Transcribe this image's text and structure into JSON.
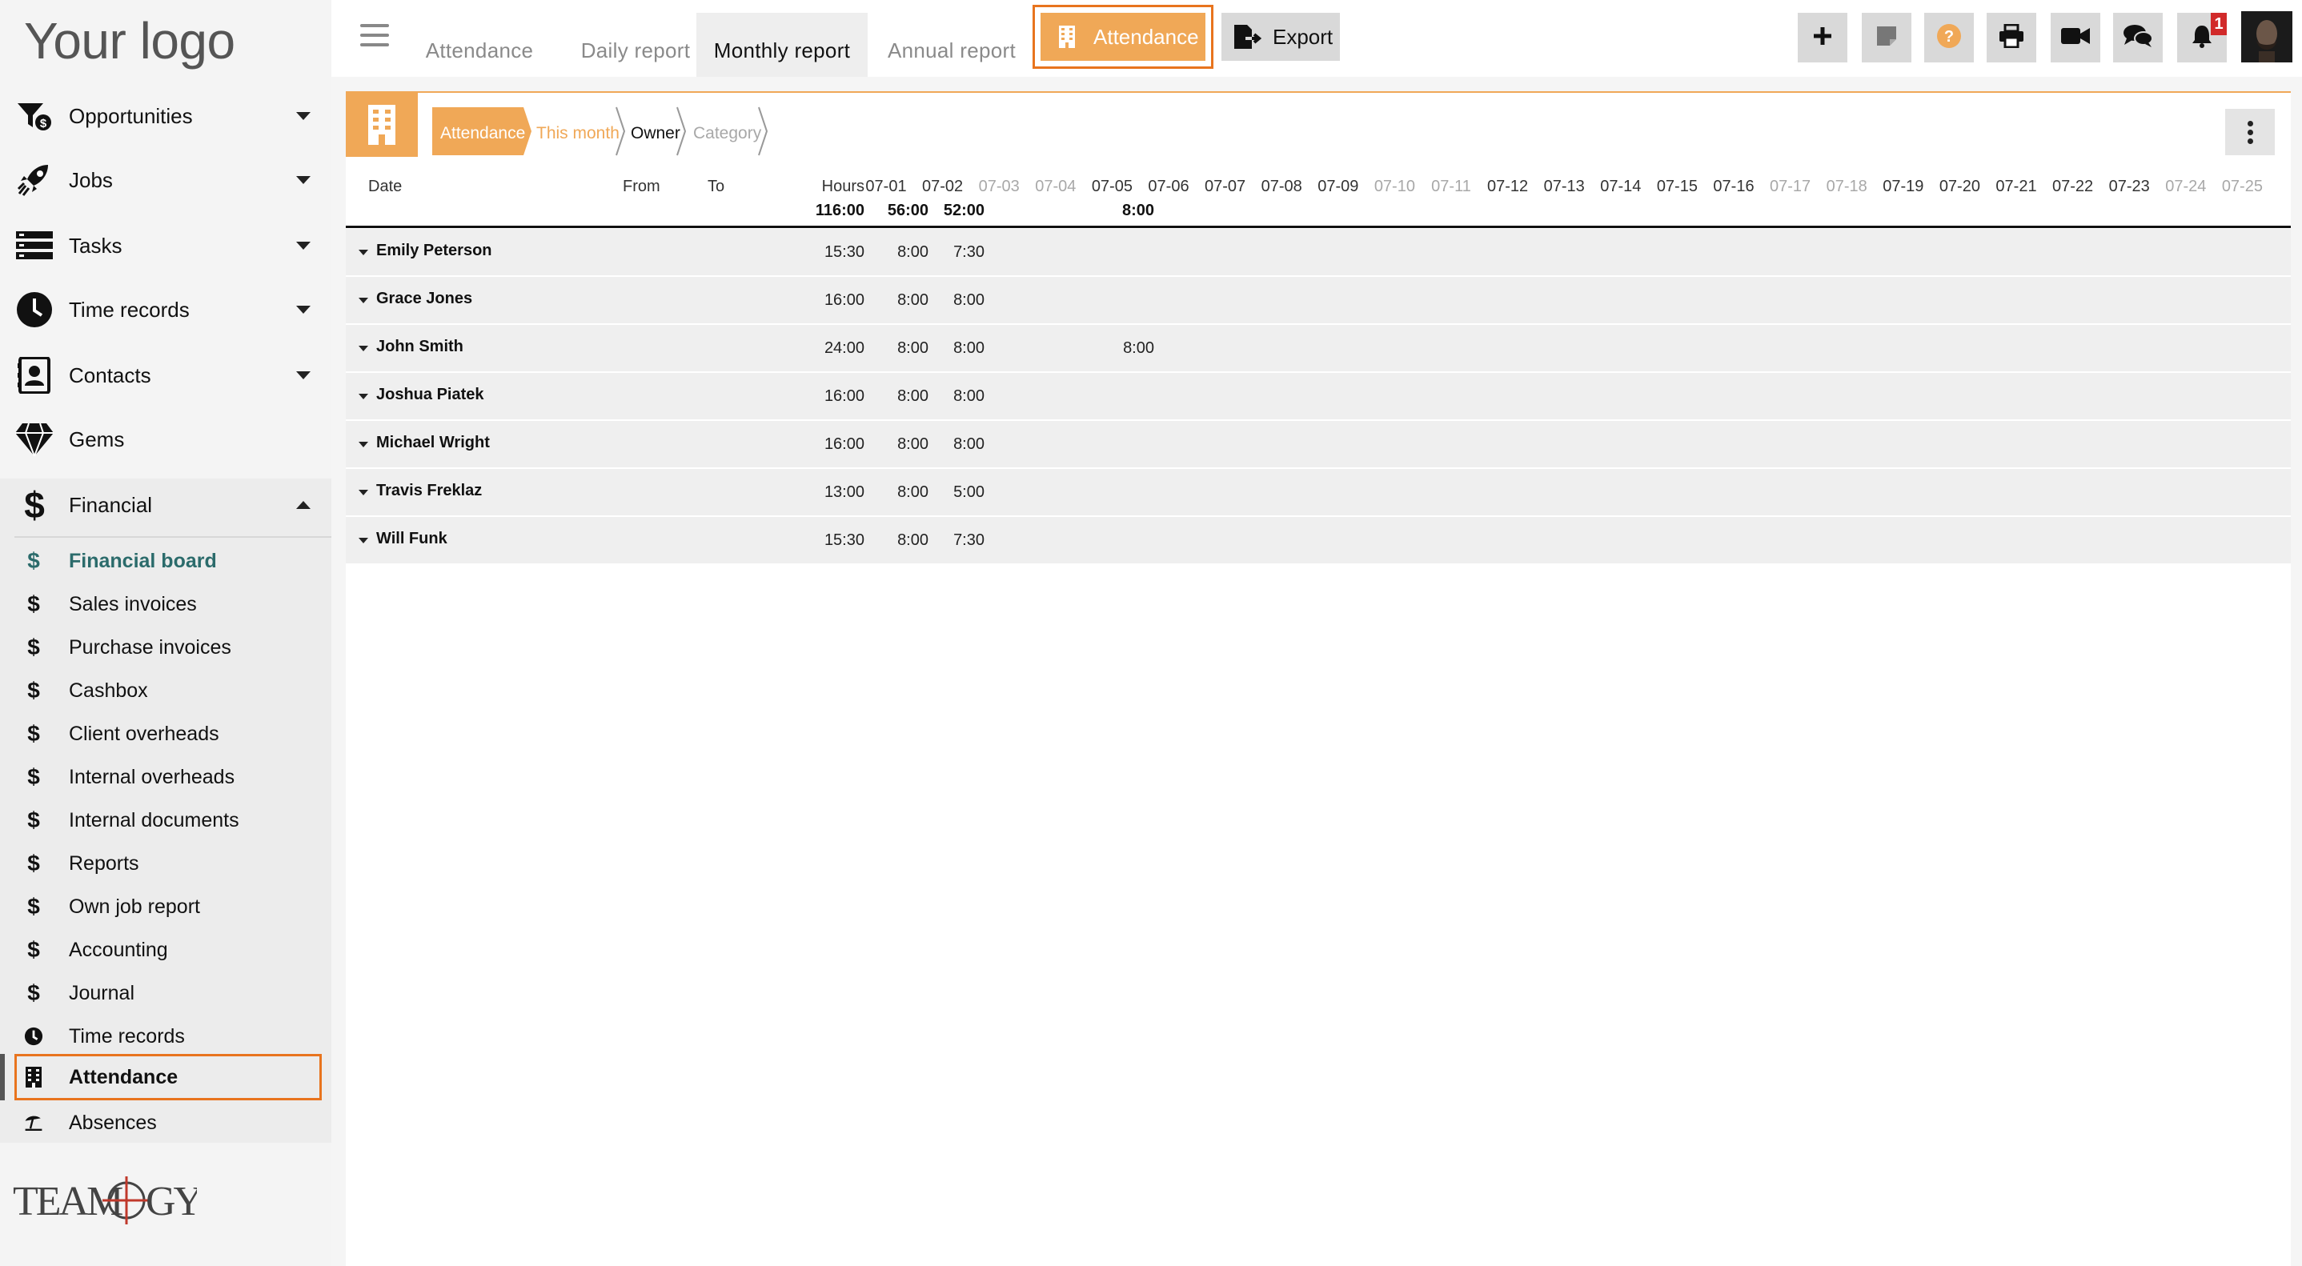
{
  "logo": {
    "text": "Your logo"
  },
  "sidebar": {
    "items": [
      {
        "label": "Opportunities",
        "icon": "funnel-dollar-icon",
        "expandable": true
      },
      {
        "label": "Jobs",
        "icon": "rocket-icon",
        "expandable": true
      },
      {
        "label": "Tasks",
        "icon": "tasks-icon",
        "expandable": true
      },
      {
        "label": "Time records",
        "icon": "clock-icon",
        "expandable": true
      },
      {
        "label": "Contacts",
        "icon": "contacts-icon",
        "expandable": true
      },
      {
        "label": "Gems",
        "icon": "gem-icon",
        "expandable": false
      },
      {
        "label": "Financial",
        "icon": "dollar-icon",
        "expandable": true,
        "expanded": true
      }
    ],
    "financial_items": [
      {
        "label": "Financial board",
        "icon": "$",
        "active": true
      },
      {
        "label": "Sales invoices",
        "icon": "$"
      },
      {
        "label": "Purchase invoices",
        "icon": "$"
      },
      {
        "label": "Cashbox",
        "icon": "$"
      },
      {
        "label": "Client overheads",
        "icon": "$"
      },
      {
        "label": "Internal overheads",
        "icon": "$"
      },
      {
        "label": "Internal documents",
        "icon": "$"
      },
      {
        "label": "Reports",
        "icon": "$"
      },
      {
        "label": "Own job report",
        "icon": "$"
      },
      {
        "label": "Accounting",
        "icon": "$"
      },
      {
        "label": "Journal",
        "icon": "$"
      },
      {
        "label": "Time records",
        "icon": "clock"
      },
      {
        "label": "Attendance",
        "icon": "building",
        "selected": true
      },
      {
        "label": "Absences",
        "icon": "beach"
      }
    ],
    "brand_logo": "TEAMOGY"
  },
  "topbar": {
    "tabs": [
      {
        "label": "Attendance",
        "active": false
      },
      {
        "label": "Daily report",
        "active": false
      },
      {
        "label": "Monthly report",
        "active": true
      },
      {
        "label": "Annual report",
        "active": false
      }
    ],
    "attendance_button": "Attendance",
    "export_button": "Export",
    "notification_count": "1"
  },
  "filter": {
    "breadcrumb": [
      "Attendance",
      "This month",
      "Owner",
      "Category"
    ]
  },
  "table": {
    "headers": {
      "date": "Date",
      "from": "From",
      "to": "To",
      "hours": "Hours"
    },
    "days": [
      "07-01",
      "07-02",
      "07-03",
      "07-04",
      "07-05",
      "07-06",
      "07-07",
      "07-08",
      "07-09",
      "07-10",
      "07-11",
      "07-12",
      "07-13",
      "07-14",
      "07-15",
      "07-16",
      "07-17",
      "07-18",
      "07-19",
      "07-20",
      "07-21",
      "07-22",
      "07-23",
      "07-24",
      "07-25"
    ],
    "weekend_days": [
      "07-03",
      "07-04",
      "07-10",
      "07-11",
      "07-17",
      "07-18",
      "07-24",
      "07-25"
    ],
    "totals": {
      "hours": "116:00",
      "07-01": "56:00",
      "07-02": "52:00",
      "07-06": "8:00"
    },
    "rows": [
      {
        "name": "Emily Peterson",
        "hours": "15:30",
        "d0701": "8:00",
        "d0702": "7:30",
        "d0706": ""
      },
      {
        "name": "Grace Jones",
        "hours": "16:00",
        "d0701": "8:00",
        "d0702": "8:00",
        "d0706": ""
      },
      {
        "name": "John Smith",
        "hours": "24:00",
        "d0701": "8:00",
        "d0702": "8:00",
        "d0706": "8:00"
      },
      {
        "name": "Joshua Piatek",
        "hours": "16:00",
        "d0701": "8:00",
        "d0702": "8:00",
        "d0706": ""
      },
      {
        "name": "Michael Wright",
        "hours": "16:00",
        "d0701": "8:00",
        "d0702": "8:00",
        "d0706": ""
      },
      {
        "name": "Travis Freklaz",
        "hours": "13:00",
        "d0701": "8:00",
        "d0702": "5:00",
        "d0706": ""
      },
      {
        "name": "Will Funk",
        "hours": "15:30",
        "d0701": "8:00",
        "d0702": "7:30",
        "d0706": ""
      }
    ]
  },
  "colors": {
    "accent": "#f0a857",
    "highlight": "#e8741e",
    "active_link": "#2b6b6b"
  }
}
